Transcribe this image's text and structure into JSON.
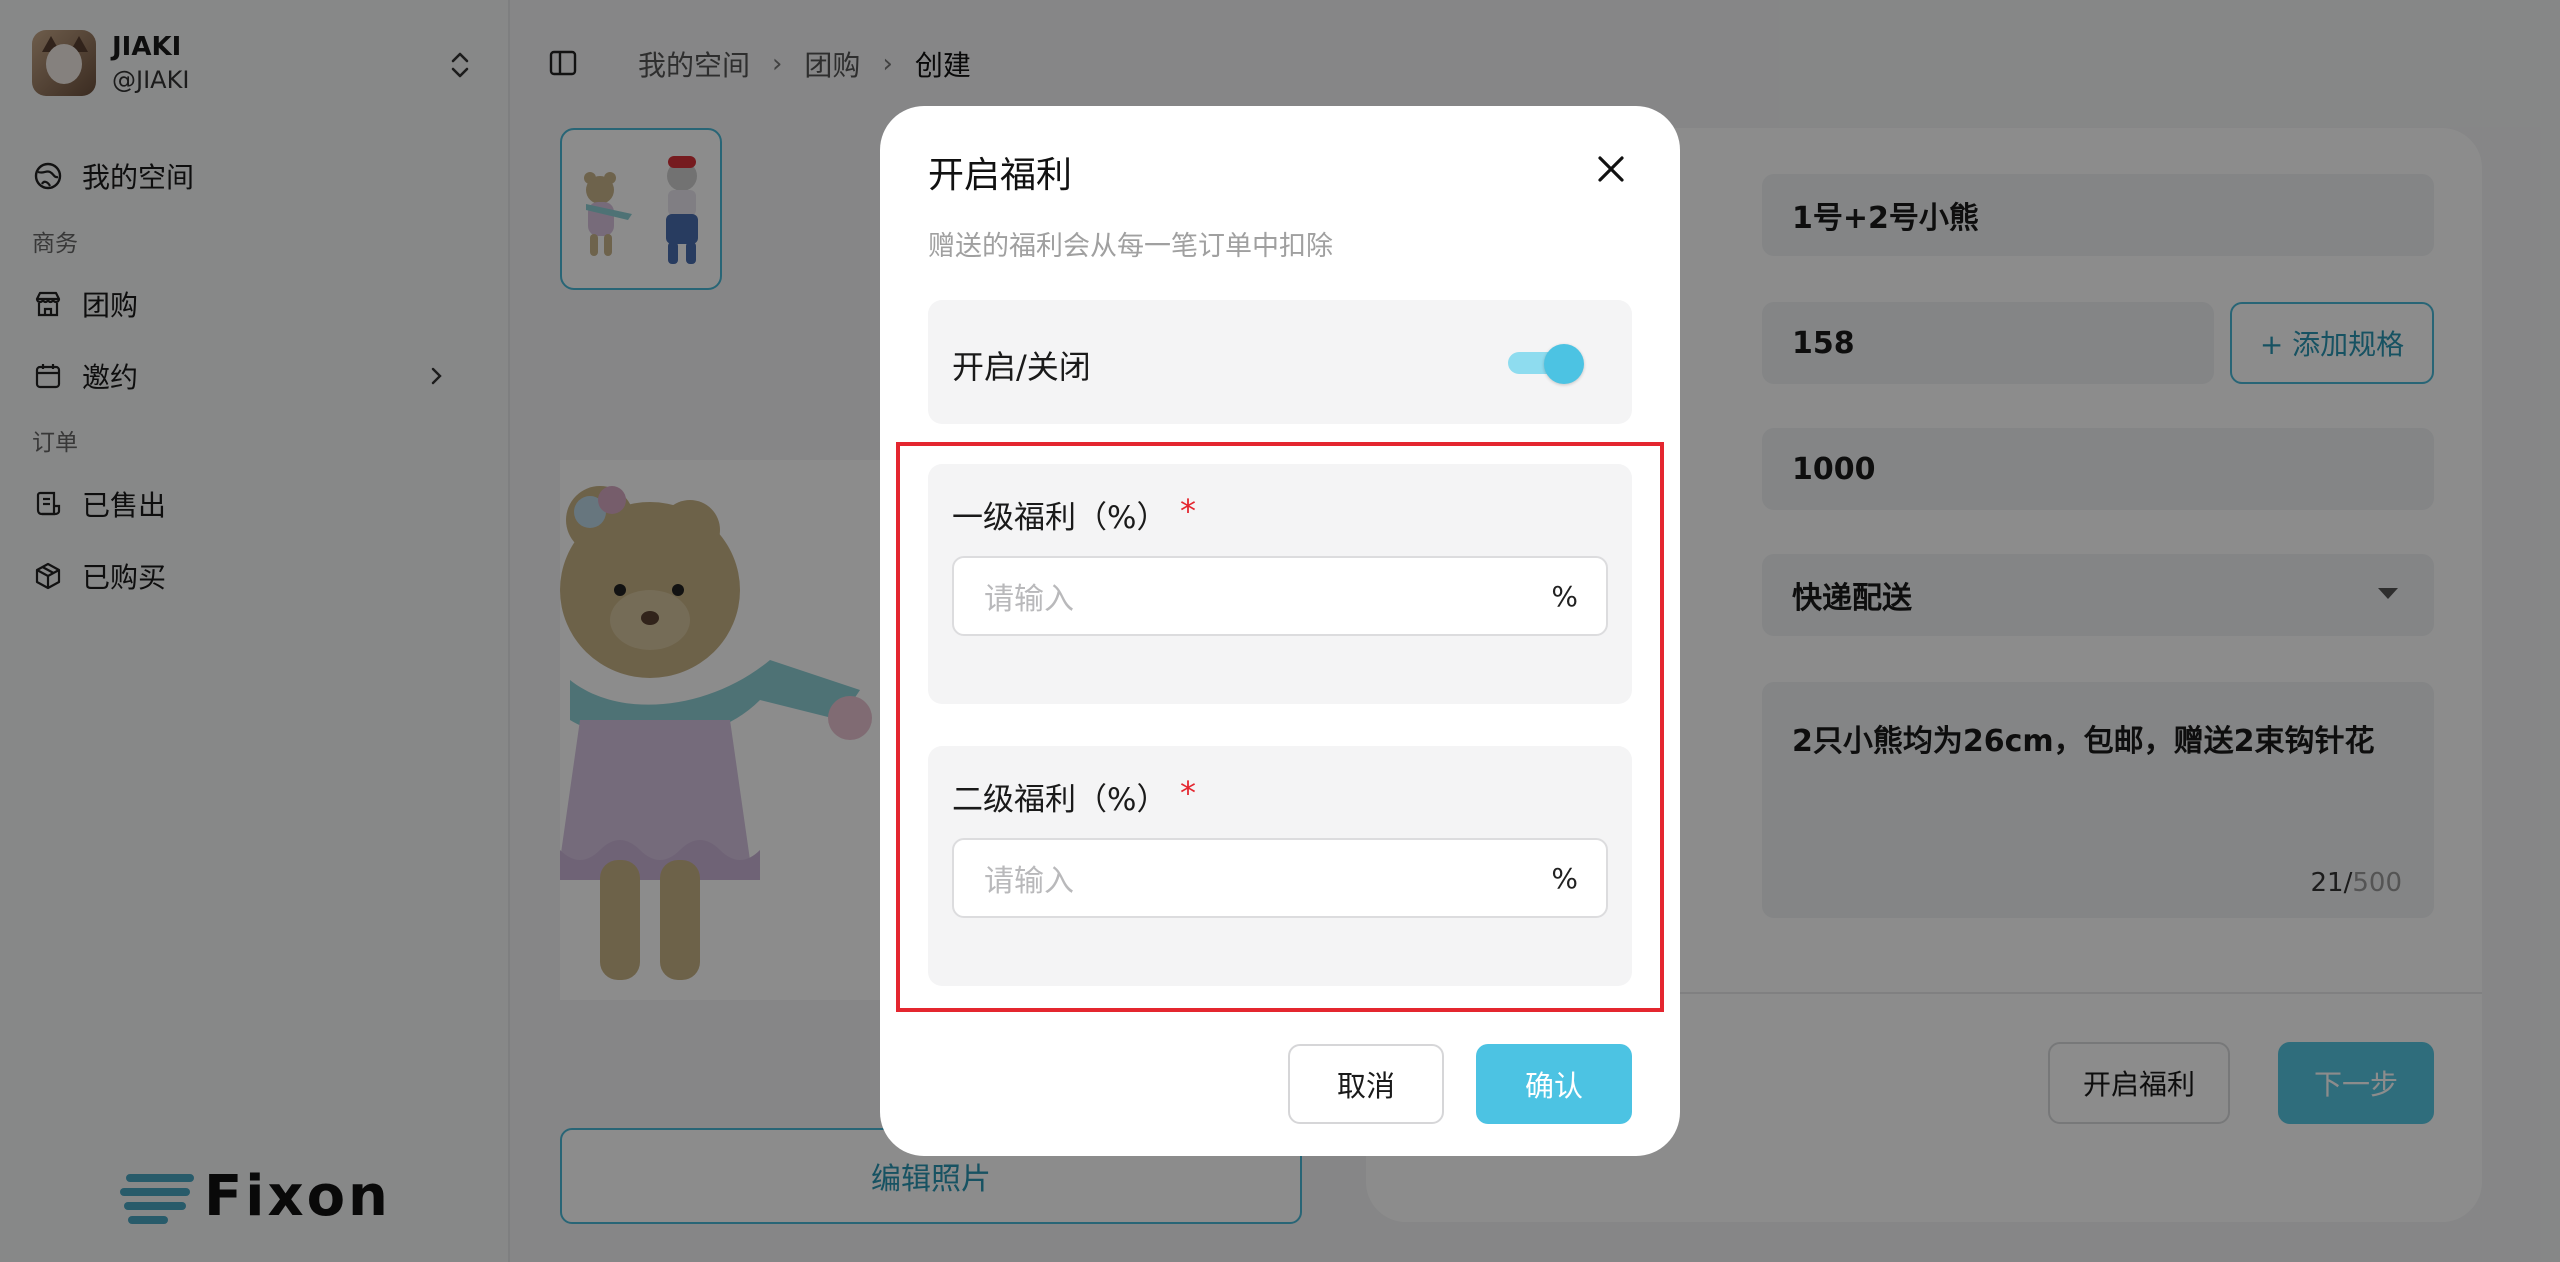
{
  "sidebar": {
    "account_name": "JIAKI",
    "account_handle": "@JIAKI",
    "items": [
      {
        "label": "我的空间",
        "icon": "globe-icon"
      },
      {
        "label": "团购",
        "icon": "store-icon"
      },
      {
        "label": "邀约",
        "icon": "calendar-icon"
      },
      {
        "label": "已售出",
        "icon": "receipt-icon"
      },
      {
        "label": "已购买",
        "icon": "box-icon"
      }
    ],
    "sections": {
      "business": "商务",
      "orders": "订单"
    },
    "logo_text": "Fixon"
  },
  "breadcrumb": [
    "我的空间",
    "团购",
    "创建"
  ],
  "main": {
    "edit_photo_label": "编辑照片",
    "fields": {
      "name": "1号+2号小熊",
      "price": "158",
      "stock": "1000",
      "delivery": "快递配送",
      "description": "2只小熊均为26cm，包邮，赠送2束钩针花",
      "desc_count": "21",
      "desc_max": "500"
    },
    "add_spec_label": "+ 添加规格",
    "welfare_button": "开启福利",
    "next_button": "下一步"
  },
  "modal": {
    "title": "开启福利",
    "subtitle": "赠送的福利会从每一笔订单中扣除",
    "toggle_label": "开启/关闭",
    "toggle_on": true,
    "level1_label": "一级福利（%）",
    "level2_label": "二级福利（%）",
    "required_mark": "*",
    "input_placeholder": "请输入",
    "unit": "%",
    "cancel_label": "取消",
    "confirm_label": "确认"
  },
  "colors": {
    "accent": "#4cc3e3",
    "required": "#e4262f",
    "highlight_border": "#e4262f"
  }
}
